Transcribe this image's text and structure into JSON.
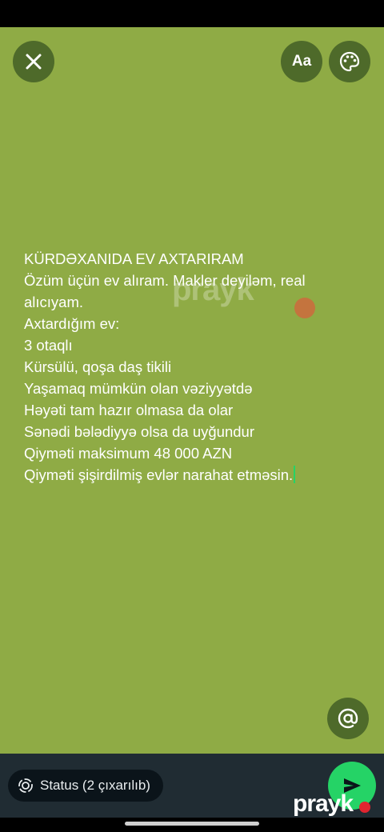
{
  "toolbar": {
    "close_icon": "close-icon",
    "font_label": "Aa",
    "palette_icon": "palette-icon",
    "mention_icon": "at-icon"
  },
  "story": {
    "lines": [
      "KÜRDƏXANIDA EV AXTARIRAM",
      "Özüm üçün ev alıram. Makler deyiləm, real",
      "alıcıyam.",
      "Axtardığım ev:",
      "3 otaqlı",
      "Kürsülü, qoşa daş tikili",
      "Yaşamaq mümkün olan vəziyyətdə",
      "Həyəti tam hazır olmasa da olar",
      "Sənədi bələdiyyə olsa da uyğundur",
      "Qiyməti maksimum 48 000 AZN",
      "Qiyməti şişirdilmiş evlər narahat etməsin."
    ],
    "background_color": "#8fab45"
  },
  "bottom": {
    "status_label": "Status (2 çıxarılıb)",
    "send_icon": "send-icon"
  },
  "watermark": {
    "text": "prayk"
  },
  "colors": {
    "accent": "#25d366",
    "button_bg": "#4e6a2a",
    "bar_bg": "#202c33"
  }
}
